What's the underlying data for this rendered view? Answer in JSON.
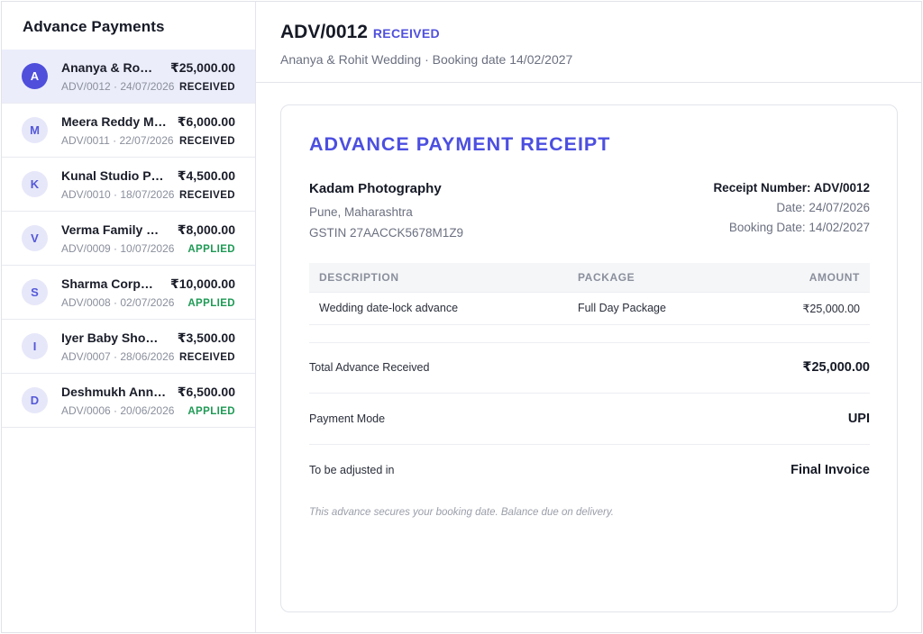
{
  "sidebar": {
    "title": "Advance Payments",
    "items": [
      {
        "initial": "A",
        "name": "Ananya & Ro…",
        "amount": "₹25,000.00",
        "meta": "ADV/0012 · 24/07/2026",
        "status": "RECEIVED",
        "active": true
      },
      {
        "initial": "M",
        "name": "Meera Reddy M…",
        "amount": "₹6,000.00",
        "meta": "ADV/0011 · 22/07/2026",
        "status": "RECEIVED",
        "active": false
      },
      {
        "initial": "K",
        "name": "Kunal Studio P…",
        "amount": "₹4,500.00",
        "meta": "ADV/0010 · 18/07/2026",
        "status": "RECEIVED",
        "active": false
      },
      {
        "initial": "V",
        "name": "Verma Family …",
        "amount": "₹8,000.00",
        "meta": "ADV/0009 · 10/07/2026",
        "status": "APPLIED",
        "active": false
      },
      {
        "initial": "S",
        "name": "Sharma Corp…",
        "amount": "₹10,000.00",
        "meta": "ADV/0008 · 02/07/2026",
        "status": "APPLIED",
        "active": false
      },
      {
        "initial": "I",
        "name": "Iyer Baby Sho…",
        "amount": "₹3,500.00",
        "meta": "ADV/0007 · 28/06/2026",
        "status": "RECEIVED",
        "active": false
      },
      {
        "initial": "D",
        "name": "Deshmukh Ann…",
        "amount": "₹6,500.00",
        "meta": "ADV/0006 · 20/06/2026",
        "status": "APPLIED",
        "active": false
      }
    ]
  },
  "header": {
    "id": "ADV/0012",
    "status": "RECEIVED",
    "subtitle": "Ananya & Rohit Wedding · Booking date 14/02/2027"
  },
  "receipt": {
    "title": "ADVANCE PAYMENT RECEIPT",
    "business": {
      "name": "Kadam Photography",
      "location": "Pune, Maharashtra",
      "gstin": "GSTIN 27AACCK5678M1Z9"
    },
    "receipt_number": "Receipt Number: ADV/0012",
    "date": "Date: 24/07/2026",
    "booking_date": "Booking Date: 14/02/2027",
    "table": {
      "headers": [
        "DESCRIPTION",
        "PACKAGE",
        "AMOUNT"
      ],
      "rows": [
        {
          "description": "Wedding date-lock advance",
          "package": "Full Day Package",
          "amount": "₹25,000.00"
        }
      ]
    },
    "total_label": "Total Advance Received",
    "total_value": "₹25,000.00",
    "payment_mode_label": "Payment Mode",
    "payment_mode_value": "UPI",
    "adjusted_label": "To be adjusted in",
    "adjusted_value": "Final Invoice",
    "note": "This advance secures your booking date. Balance due on delivery."
  },
  "colors": {
    "accent": "#4c4fe0",
    "applied": "#1f9a55",
    "active_row_bg": "#ecedfb"
  }
}
